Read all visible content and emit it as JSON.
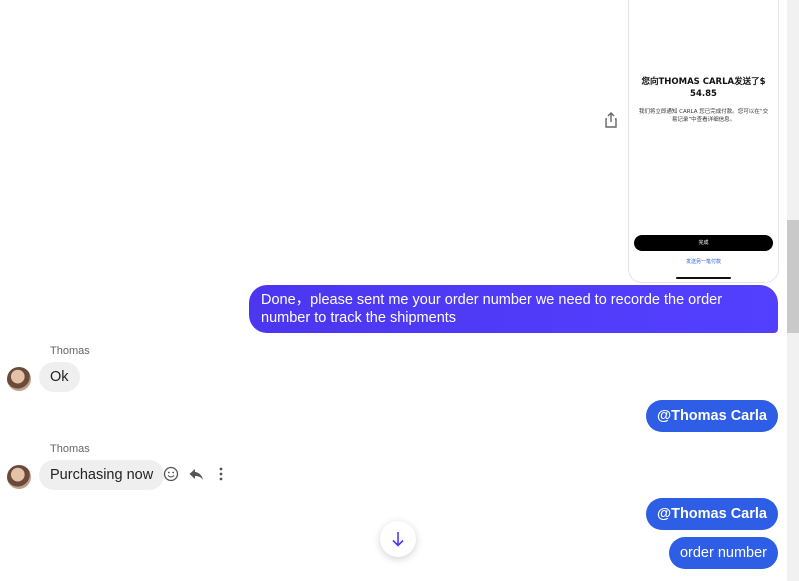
{
  "image_card": {
    "title": "您向THOMAS CARLA发送了$ 54.85",
    "description": "我们将立即通知 CARLA 您已完成付款。您可以在“交易记录”中查看详细信息。",
    "done_button": "完成",
    "link_text": "发送另一笔付款"
  },
  "messages": {
    "outgoing_1": "Done，please sent me your order number we need to recorde the order number to track the shipments",
    "incoming_1": {
      "sender": "Thomas",
      "text": "Ok"
    },
    "outgoing_2": "@Thomas Carla",
    "incoming_2": {
      "sender": "Thomas",
      "text": "Purchasing now"
    },
    "outgoing_3": "@Thomas Carla",
    "outgoing_4": "order number"
  },
  "icons": {
    "share": "share-icon",
    "emoji": "smiley-icon",
    "reply": "reply-icon",
    "more": "more-vertical-icon",
    "scroll_down": "arrow-down-icon"
  },
  "colors": {
    "outgoing_bubble": "#4b3bf5",
    "mention_bubble": "#2e5de6",
    "incoming_bubble": "#efefef"
  }
}
